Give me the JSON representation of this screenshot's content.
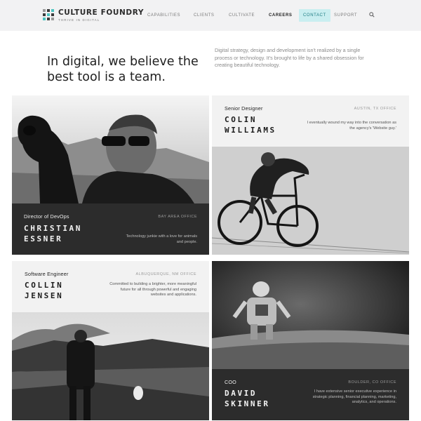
{
  "brand": {
    "name": "CULTURE FOUNDRY",
    "tagline": "THRIVE IN DIGITAL",
    "colors": {
      "accent": "#4cc3c0",
      "contact_bg": "#c9eef0",
      "dark_panel": "#2c2c2c",
      "light_panel": "#f2f2f2"
    }
  },
  "nav": {
    "items": [
      {
        "label": "CAPABILITIES"
      },
      {
        "label": "CLIENTS"
      },
      {
        "label": "CULTIVATE"
      },
      {
        "label": "CAREERS"
      },
      {
        "label": "CONTACT"
      },
      {
        "label": "SUPPORT"
      }
    ],
    "active": "CAREERS",
    "highlighted": "CONTACT",
    "search_icon": "search-icon"
  },
  "intro": {
    "title": "In digital, we believe the best tool is a team.",
    "subtitle": "Digital strategy, design and development isn't realized by a single process or technology. It's brought to life by a shared obsession for creating beautiful technology."
  },
  "team": [
    {
      "role": "Director of DevOps",
      "office": "BAY AREA OFFICE",
      "first": "CHRISTIAN",
      "last": "ESSNER",
      "bio": "Technology junkie with a love for animals and people."
    },
    {
      "role": "Senior Designer",
      "office": "AUSTIN, TX OFFICE",
      "first": "COLIN",
      "last": "WILLIAMS",
      "bio": "I eventually wound my way into the conversation as the agency's 'Website guy.'"
    },
    {
      "role": "Software Engineer",
      "office": "ALBUQUERQUE, NM OFFICE",
      "first": "COLLIN",
      "last": "JENSEN",
      "bio": "Committed to building a brighter, more meaningful future for all through powerful and engaging websites and applications."
    },
    {
      "role": "COO",
      "office": "BOULDER, CO OFFICE",
      "first": "DAVID",
      "last": "SKINNER",
      "bio": "I have extensive senior executive experience in strategic planning, financial planning, marketing, analytics, and operations."
    }
  ]
}
